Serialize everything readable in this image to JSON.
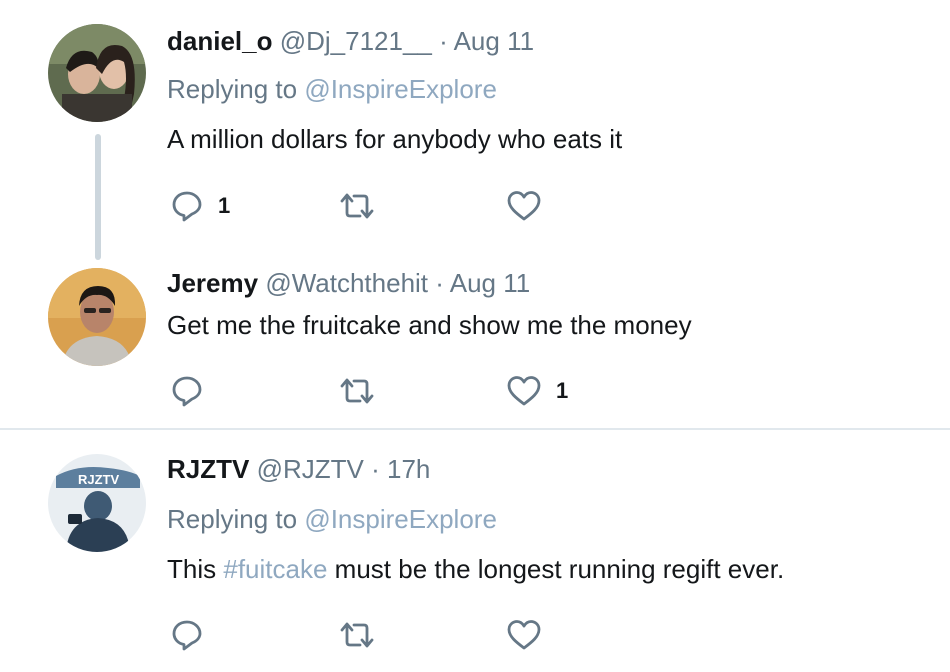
{
  "tweets": [
    {
      "name": "daniel_o",
      "handle": "@Dj_7121__",
      "separator": "·",
      "time": "Aug 11",
      "replying_prefix": "Replying to",
      "replying_to": "@InspireExplore",
      "text": "A million dollars for anybody who eats it",
      "reply_count": "1",
      "like_count": ""
    },
    {
      "name": "Jeremy",
      "handle": "@Watchthehit",
      "separator": "·",
      "time": "Aug 11",
      "text": "Get me the fruitcake and show me the money",
      "reply_count": "",
      "like_count": "1"
    },
    {
      "name": "RJZTV",
      "handle": "@RJZTV",
      "separator": "·",
      "time": "17h",
      "replying_prefix": "Replying to",
      "replying_to": "@InspireExplore",
      "text_before": "This",
      "hashtag": "#fuitcake",
      "text_after": "must be the longest running regift ever.",
      "reply_count": "",
      "like_count": "",
      "avatar_text": "RJZTV"
    }
  ],
  "icons": [
    "reply-icon",
    "retweet-icon",
    "like-icon"
  ],
  "colors": {
    "muted": "#657786",
    "link": "#8fa8c0",
    "icon": "#657786",
    "divider": "#e1e8ed",
    "thread": "#ccd6dd"
  }
}
